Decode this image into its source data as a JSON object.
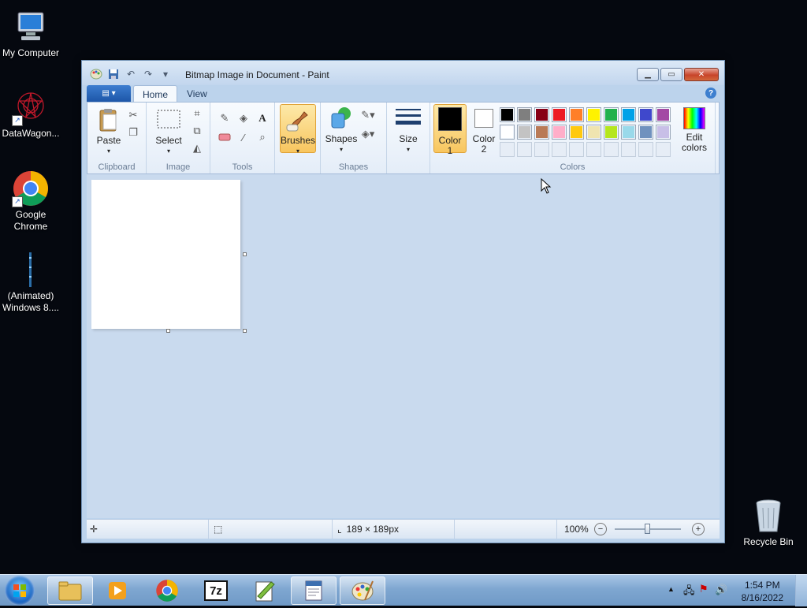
{
  "desktop": {
    "icons": [
      {
        "label": "My Computer"
      },
      {
        "label": "DataWagon..."
      },
      {
        "label": "Google Chrome"
      },
      {
        "label": "(Animated) Windows 8...."
      },
      {
        "label": "Recycle Bin"
      }
    ]
  },
  "window": {
    "title": "Bitmap Image in Document - Paint",
    "tabs": [
      {
        "label": "Home"
      },
      {
        "label": "View"
      }
    ],
    "help_glyph": "?"
  },
  "ribbon": {
    "groups": {
      "clipboard": "Clipboard",
      "image": "Image",
      "tools": "Tools",
      "shapes": "Shapes",
      "colors": "Colors"
    },
    "buttons": {
      "paste": "Paste",
      "select": "Select",
      "brushes": "Brushes",
      "shapes": "Shapes",
      "size": "Size",
      "color1": "Color 1",
      "color2": "Color 2",
      "edit_colors": "Edit colors"
    },
    "color1": "#000000",
    "color2": "#ffffff",
    "palette_row1": [
      "#000000",
      "#7f7f7f",
      "#880015",
      "#ed1c24",
      "#ff7f27",
      "#fff200",
      "#22b14c",
      "#00a2e8",
      "#3f48cc",
      "#a349a4"
    ],
    "palette_row2": [
      "#ffffff",
      "#c3c3c3",
      "#b97a57",
      "#ffaec9",
      "#ffc90e",
      "#efe4b0",
      "#b5e61d",
      "#99d9ea",
      "#7092be",
      "#c8bfe7"
    ]
  },
  "statusbar": {
    "image_size": "189 × 189px",
    "zoom": "100%"
  },
  "taskbar": {
    "time": "1:54 PM",
    "date": "8/16/2022",
    "sevenzip_label": "7z"
  }
}
